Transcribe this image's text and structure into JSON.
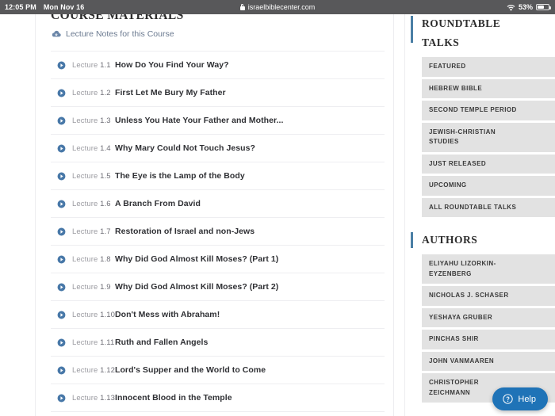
{
  "statusbar": {
    "time": "12:05 PM",
    "date": "Mon Nov 16",
    "url": "israelbiblecenter.com",
    "lock_icon": "lock-icon",
    "wifi_icon": "wifi-icon",
    "battery_percent": "53%",
    "battery_icon": "battery-icon"
  },
  "main": {
    "section_title": "COURSE MATERIALS",
    "notes_link": "Lecture Notes for this Course",
    "notes_icon": "cloud-download-icon",
    "lecture_label": "Lecture",
    "lectures": [
      {
        "number": "1.1",
        "title": "How Do You Find Your Way?"
      },
      {
        "number": "1.2",
        "title": "First Let Me Bury My Father"
      },
      {
        "number": "1.3",
        "title": "Unless You Hate Your Father and Mother..."
      },
      {
        "number": "1.4",
        "title": "Why Mary Could Not Touch Jesus?"
      },
      {
        "number": "1.5",
        "title": "The Eye is the Lamp of the Body"
      },
      {
        "number": "1.6",
        "title": "A Branch From David"
      },
      {
        "number": "1.7",
        "title": "Restoration of Israel and non-Jews"
      },
      {
        "number": "1.8",
        "title": "Why Did God Almost Kill Moses? (Part 1)"
      },
      {
        "number": "1.9",
        "title": "Why Did God Almost Kill Moses? (Part 2)"
      },
      {
        "number": "1.10",
        "title": "Don't Mess with Abraham!"
      },
      {
        "number": "1.11",
        "title": "Ruth and Fallen Angels"
      },
      {
        "number": "1.12",
        "title": "Lord's Supper and the World to Come"
      },
      {
        "number": "1.13",
        "title": "Innocent Blood in the Temple"
      }
    ]
  },
  "sidebar": {
    "roundtable": {
      "heading_line1": "ROUNDTABLE",
      "heading_line2": "TALKS",
      "items": [
        {
          "line1": "FEATURED"
        },
        {
          "line1": "HEBREW BIBLE"
        },
        {
          "line1": "SECOND TEMPLE PERIOD"
        },
        {
          "line1": "JEWISH-CHRISTIAN",
          "line2": "STUDIES"
        },
        {
          "line1": "JUST RELEASED"
        },
        {
          "line1": "UPCOMING"
        },
        {
          "line1": "ALL ROUNDTABLE TALKS"
        }
      ]
    },
    "authors": {
      "heading": "AUTHORS",
      "items": [
        {
          "line1": "ELIYAHU LIZORKIN-",
          "line2": "EYZENBERG"
        },
        {
          "line1": "NICHOLAS J. SCHASER"
        },
        {
          "line1": "YESHAYA GRUBER"
        },
        {
          "line1": "PINCHAS SHIR"
        },
        {
          "line1": "JOHN VANMAAREN"
        },
        {
          "line1": "CHRISTOPHER",
          "line2": "ZEICHMANN"
        }
      ]
    }
  },
  "help": {
    "label": "Help",
    "icon": "question-circle-icon",
    "color": "#1f73b7"
  },
  "colors": {
    "statusbar_bg": "#58585a",
    "accent_bar": "#4a7fa5",
    "chip_bg": "#e2e2e2",
    "play_icon": "#4878a8",
    "link_text": "#6b7a90"
  }
}
